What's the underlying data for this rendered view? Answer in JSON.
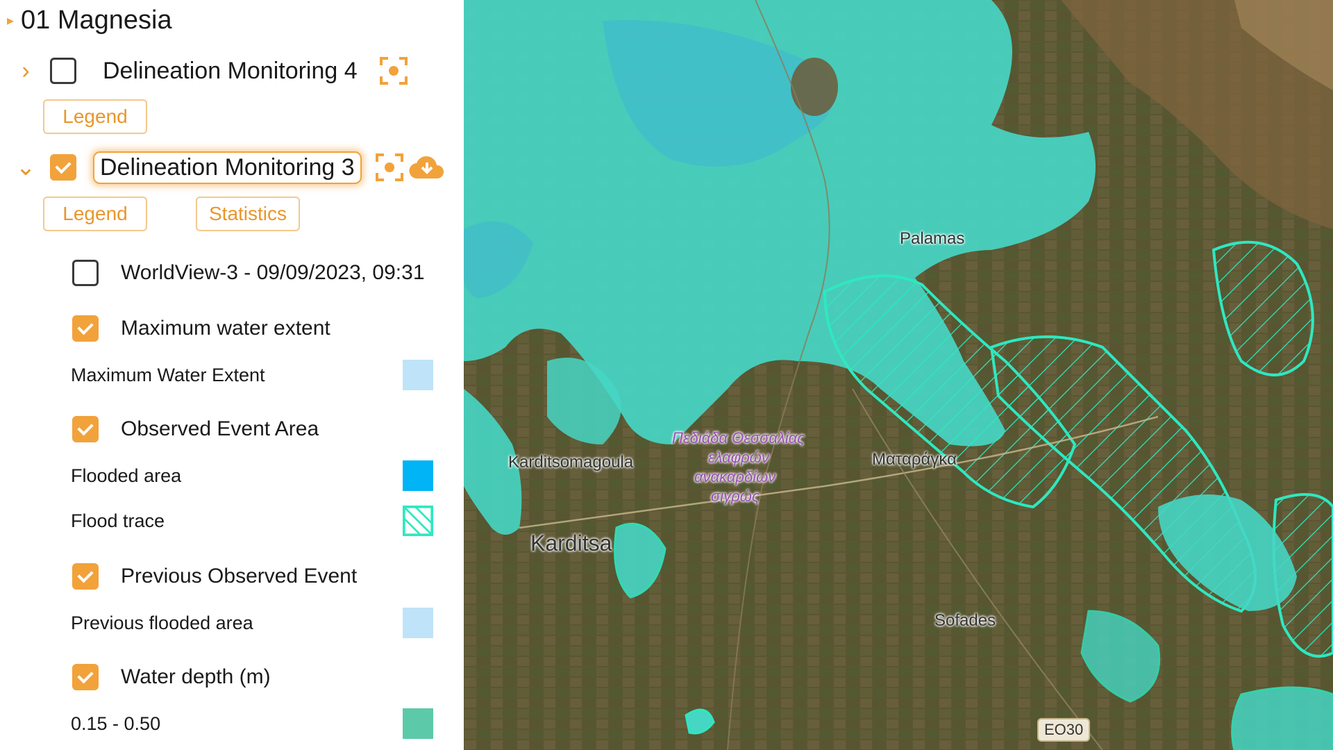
{
  "sidebar": {
    "group_title": "01 Magnesia",
    "layers": [
      {
        "name": "Delineation Monitoring 4",
        "checked": false,
        "expanded": false,
        "legend_label": "Legend"
      },
      {
        "name": "Delineation Monitoring 3",
        "checked": true,
        "expanded": true,
        "legend_label": "Legend",
        "statistics_label": "Statistics"
      }
    ],
    "sublayers": [
      {
        "label": "WorldView-3 - 09/09/2023, 09:31",
        "checked": false
      },
      {
        "label": "Maximum water extent",
        "checked": true
      },
      {
        "label": "Observed Event Area",
        "checked": true
      },
      {
        "label": "Previous Observed Event",
        "checked": true
      },
      {
        "label": "Water depth (m)",
        "checked": true
      }
    ],
    "legend_items": [
      {
        "label": "Maximum Water Extent",
        "color": "#bfe3f8"
      },
      {
        "label": "Flooded area",
        "color": "#00b4f5"
      },
      {
        "label": "Flood trace",
        "color": "#2ee8c0"
      },
      {
        "label": "Previous flooded area",
        "color": "#bfe3f8"
      },
      {
        "label": "0.15 - 0.50",
        "color": "#5cc9a8"
      }
    ]
  },
  "map": {
    "place_labels": {
      "palamas": "Palamas",
      "karditsomagoula": "Karditsomagoula",
      "karditsa": "Karditsa",
      "sofades": "Sofades",
      "mataraga": "Ματαράγκα",
      "plain_line1": "Πεδιάδα Θεσσαλίας",
      "plain_line2": "ελαφρών",
      "plain_line3": "ανακαρδίων",
      "plain_line4": "σιγρώς"
    },
    "road": "EO30",
    "colors": {
      "flood_fill": "#46d6c4",
      "flood_deep": "#3fb7d0",
      "trace_outline": "#2ee8c0",
      "terrain": "#5d5a34"
    }
  }
}
